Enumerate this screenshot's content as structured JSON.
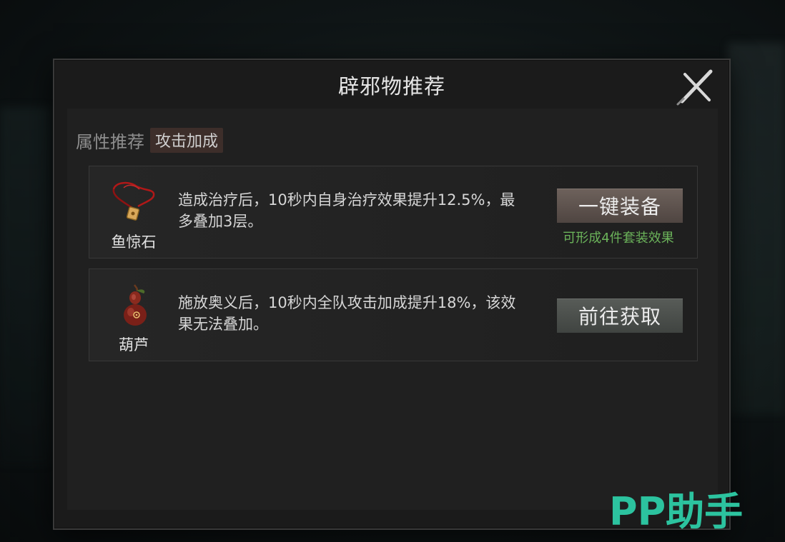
{
  "dialog": {
    "title": "辟邪物推荐"
  },
  "attribute": {
    "label": "属性推荐",
    "tag": "攻击加成"
  },
  "items": [
    {
      "name": "鱼惊石",
      "icon": "jade-pendant-necklace-icon",
      "description": "造成治疗后，10秒内自身治疗效果提升12.5%，最多叠加3层。",
      "action_label": "一键装备",
      "note": "可形成4件套装效果"
    },
    {
      "name": "葫芦",
      "icon": "gourd-icon",
      "description": "施放奥义后，10秒内全队攻击加成提升18%，该效果无法叠加。",
      "action_label": "前往获取"
    }
  ],
  "watermark": "PP助手",
  "colors": {
    "note_green": "#6bb35a",
    "watermark_teal": "#2cc39f",
    "tag_bg": "#3d2e2a"
  }
}
